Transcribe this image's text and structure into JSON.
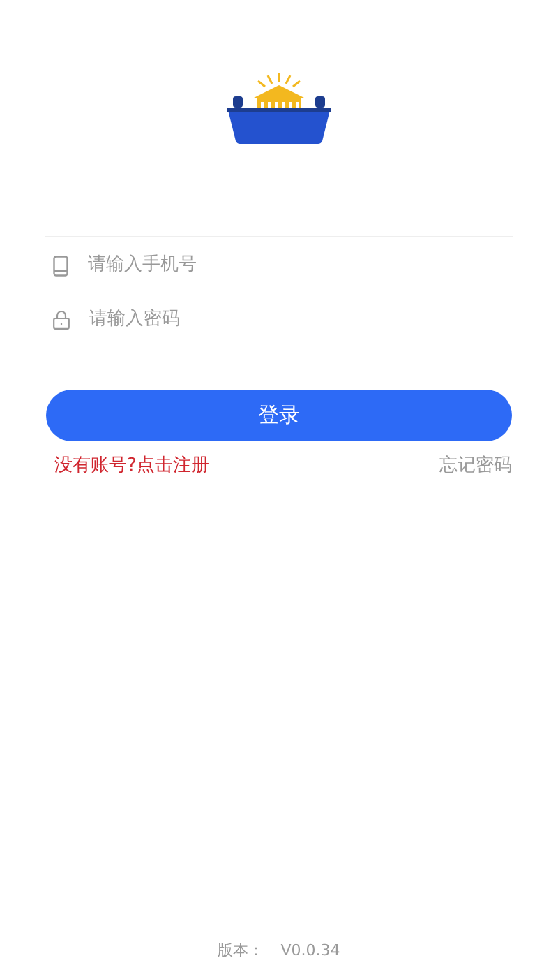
{
  "login_form": {
    "phone_field": {
      "placeholder": "请输入手机号"
    },
    "password_field": {
      "placeholder": "请输入密码"
    },
    "login_button": "登录",
    "register_link": "没有账号?点击注册",
    "forgot_password_link": "忘记密码"
  },
  "footer": {
    "version_label": "版本：",
    "version": "V0.0.34"
  }
}
